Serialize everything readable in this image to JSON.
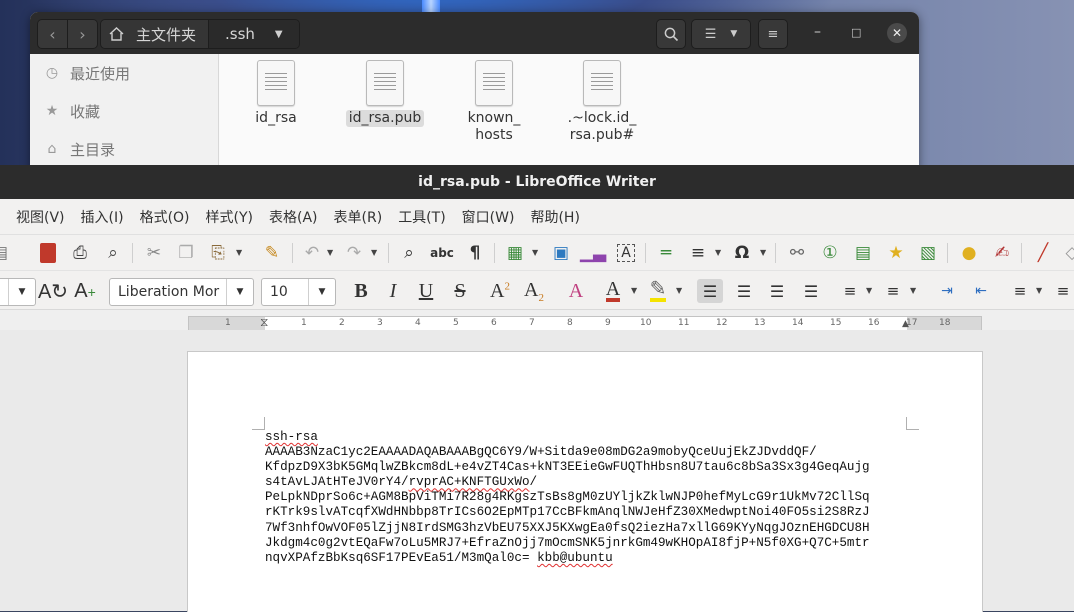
{
  "file_manager": {
    "path": {
      "home": "主文件夹",
      "current": ".ssh"
    },
    "sidebar": [
      {
        "label": "最近使用",
        "icon": "clock-icon"
      },
      {
        "label": "收藏",
        "icon": "star-icon"
      },
      {
        "label": "主目录",
        "icon": "home-icon"
      }
    ],
    "files": [
      {
        "name": "id_rsa"
      },
      {
        "name": "id_rsa.pub"
      },
      {
        "name_line1": "known_",
        "name_line2": "hosts"
      },
      {
        "name_line1": ".~lock.id_",
        "name_line2": "rsa.pub#"
      }
    ]
  },
  "writer": {
    "title": "id_rsa.pub - LibreOffice Writer",
    "menus": [
      "视图(V)",
      "插入(I)",
      "格式(O)",
      "样式(Y)",
      "表格(A)",
      "表单(R)",
      "工具(T)",
      "窗口(W)",
      "帮助(H)"
    ],
    "font_name": "Liberation Mor",
    "font_size": "10",
    "ruler_numbers": [
      "1",
      "1",
      "2",
      "3",
      "4",
      "5",
      "6",
      "7",
      "8",
      "9",
      "10",
      "11",
      "12",
      "13",
      "14",
      "15",
      "16",
      "17",
      "18"
    ],
    "doc_lines": {
      "l1": "ssh-rsa",
      "l2": "AAAAB3NzaC1yc2EAAAADAQABAAABgQC6Y9/W+Sitda9e08mDG2a9mobyQceUujEkZJDvddQF/",
      "l3": "KfdpzD9X3bK5GMqlwZBkcm8dL+e4vZT4Cas+kNT3EEieGwFUQThHbsn8U7tau6c8bSa3Sx3g4GeqAujg",
      "l4a": "s4tAvLJAtHTeJV0rY4/",
      "l4b": "rvprAC+KNFTGUxWo",
      "l4c": "/",
      "l5": "PeLpkNDprSo6c+AGM8BpViTMi7R28g4RKgszTsBs8gM0zUYljkZklwNJP0hefMyLcG9r1UkMv72CllSq",
      "l6": "rKTrk9slvATcqfXWdHNbbp8TrICs6O2EpMTp17CcBFkmAnqlNWJeHfZ30XMedwptNoi40FO5si2S8RzJ",
      "l7": "7Wf3nhfOwVOF05lZjjN8IrdSMG3hzVbEU75XXJ5KXwgEa0fsQ2iezHa7xllG69KYyNqgJOznEHGDCU8H",
      "l8": "Jkdgm4c0g2vtEQaFw7oLu5MRJ7+EfraZnOjj7mOcmSNK5jnrkGm49wKHOpAI8fjP+N5f0XG+Q7C+5mtr",
      "l9a": "nqvXPAfzBbKsq6SF17PEvEa51/M3mQal0c=",
      "l9b": "kbb@ubuntu"
    }
  }
}
